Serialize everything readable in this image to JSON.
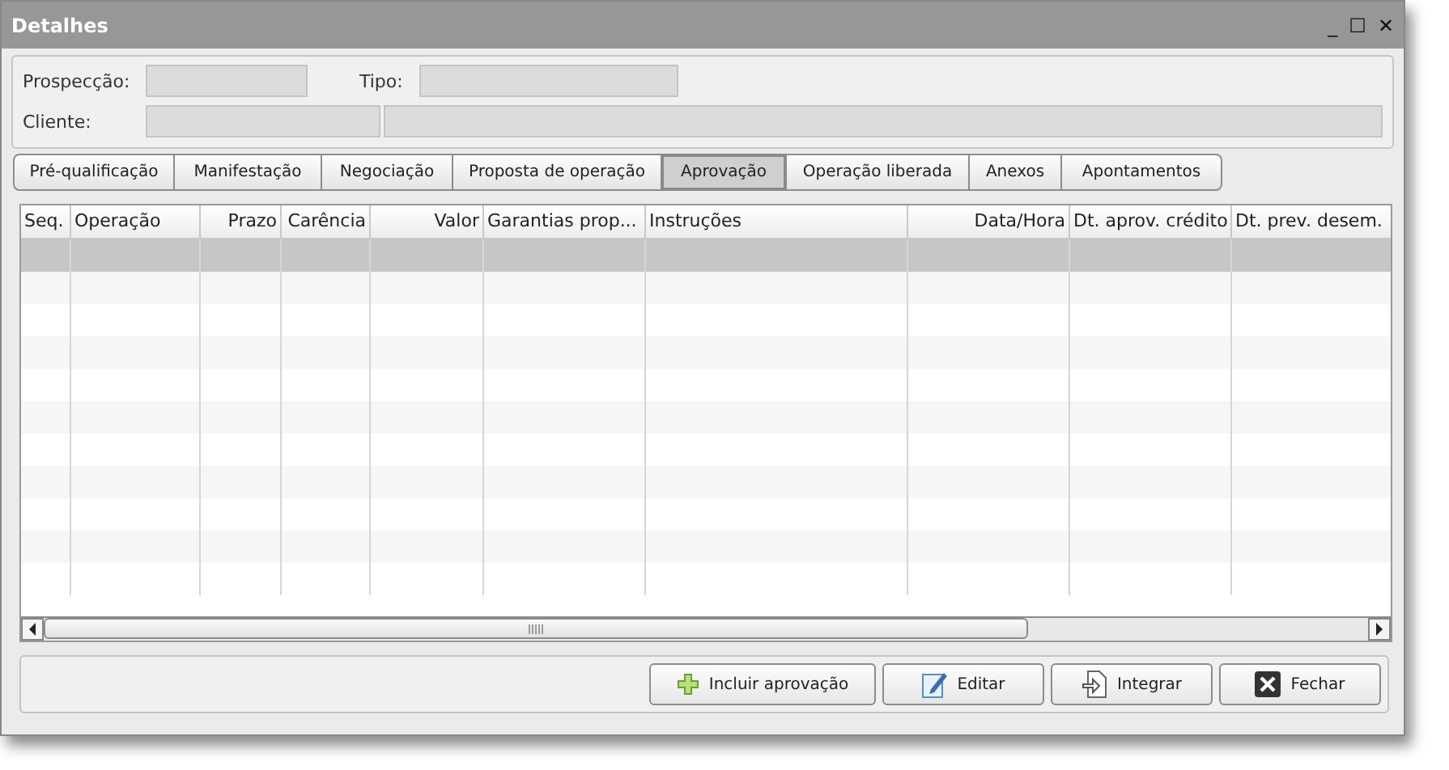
{
  "window": {
    "title": "Detalhes",
    "controls": [
      "_",
      "☐",
      "✕"
    ]
  },
  "header": {
    "fields": [
      {
        "label": "Prospecção:",
        "kind": "single"
      },
      {
        "label": "Tipo:",
        "kind": "single"
      },
      {
        "label": "Cliente:",
        "kind": "pair"
      }
    ]
  },
  "tabs": [
    {
      "label": "Pré-qualificação",
      "selected": false
    },
    {
      "label": "Manifestação",
      "selected": false
    },
    {
      "label": "Negociação",
      "selected": false
    },
    {
      "label": "Proposta de operação",
      "selected": false
    },
    {
      "label": "Aprovação",
      "selected": true
    },
    {
      "label": "Operação liberada",
      "selected": false
    },
    {
      "label": "Anexos",
      "selected": false
    },
    {
      "label": "Apontamentos",
      "selected": false
    }
  ],
  "table": {
    "columns": [
      {
        "label": "Seq.",
        "kind": "text"
      },
      {
        "label": "Operação",
        "kind": "text"
      },
      {
        "label": "Prazo",
        "kind": "number"
      },
      {
        "label": "Carência",
        "kind": "number"
      },
      {
        "label": "Valor",
        "kind": "number"
      },
      {
        "label": "Garantias prop...",
        "kind": "text"
      },
      {
        "label": "Instruções",
        "kind": "text"
      },
      {
        "label": "Data/Hora",
        "kind": "number"
      },
      {
        "label": "Dt. aprov. crédito",
        "kind": "text"
      },
      {
        "label": "Dt. prev. desem.",
        "kind": "text"
      }
    ],
    "rows": [
      {
        "selected": true
      },
      {
        "selected": false
      },
      {
        "selected": false
      },
      {
        "selected": false
      },
      {
        "selected": false
      },
      {
        "selected": false
      },
      {
        "selected": false
      },
      {
        "selected": false
      },
      {
        "selected": false
      },
      {
        "selected": false
      },
      {
        "selected": false
      }
    ]
  },
  "buttons": [
    {
      "label": "Incluir aprovação",
      "kind": "add"
    },
    {
      "label": "Editar",
      "kind": "edit"
    },
    {
      "label": "Integrar",
      "kind": "import"
    },
    {
      "label": "Fechar",
      "kind": "close"
    }
  ]
}
